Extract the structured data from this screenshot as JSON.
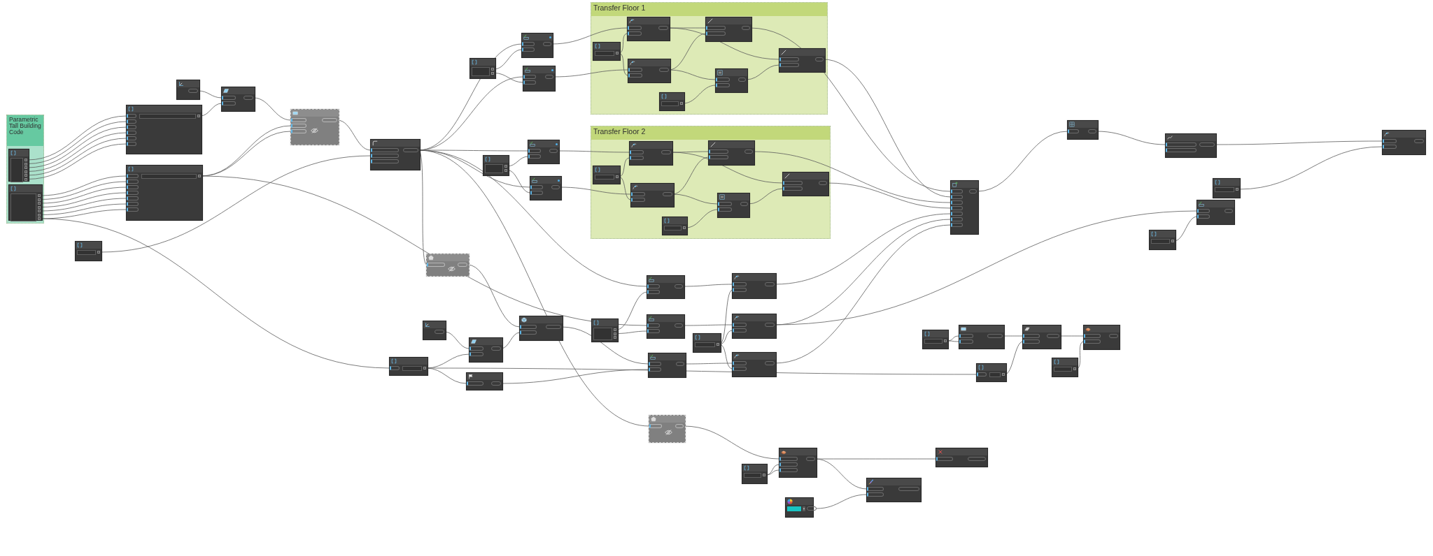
{
  "groups": [
    {
      "title": "Parametric Tall Building Code",
      "color": "#66c9a1"
    },
    {
      "title": "Transfer Floor 1",
      "color": "#c2d87a"
    },
    {
      "title": "Transfer Floor 2",
      "color": "#c2d87a"
    }
  ],
  "nodes": [
    {
      "kind": "code"
    },
    {
      "kind": "code"
    },
    {
      "kind": "function",
      "frozen": false
    },
    {
      "kind": "function",
      "frozen": false
    },
    {
      "kind": "code"
    },
    {
      "kind": "code"
    },
    {
      "kind": "function",
      "frozen": true
    },
    {
      "kind": "code"
    },
    {
      "kind": "function",
      "frozen": false
    },
    {
      "kind": "code"
    },
    {
      "kind": "function",
      "frozen": false
    },
    {
      "kind": "function",
      "frozen": false
    },
    {
      "kind": "code"
    },
    {
      "kind": "function",
      "frozen": false
    },
    {
      "kind": "function",
      "frozen": false
    },
    {
      "kind": "function",
      "frozen": false
    },
    {
      "kind": "code"
    },
    {
      "kind": "function",
      "frozen": false
    },
    {
      "kind": "function",
      "frozen": false
    },
    {
      "kind": "function",
      "frozen": false
    },
    {
      "kind": "function",
      "frozen": false
    },
    {
      "kind": "code"
    },
    {
      "kind": "function",
      "frozen": false
    },
    {
      "kind": "code"
    },
    {
      "kind": "function",
      "frozen": false
    },
    {
      "kind": "function",
      "frozen": false
    },
    {
      "kind": "function",
      "frozen": false
    },
    {
      "kind": "function",
      "frozen": false
    },
    {
      "kind": "code"
    },
    {
      "kind": "function",
      "frozen": true
    },
    {
      "kind": "function",
      "frozen": false
    },
    {
      "kind": "function",
      "frozen": false
    },
    {
      "kind": "function",
      "frozen": false
    },
    {
      "kind": "code"
    },
    {
      "kind": "function",
      "frozen": false
    },
    {
      "kind": "code"
    },
    {
      "kind": "function",
      "frozen": false
    },
    {
      "kind": "function",
      "frozen": false
    },
    {
      "kind": "function",
      "frozen": false
    },
    {
      "kind": "code"
    },
    {
      "kind": "function",
      "frozen": false
    },
    {
      "kind": "function",
      "frozen": false
    },
    {
      "kind": "function",
      "frozen": false
    },
    {
      "kind": "function",
      "frozen": false
    },
    {
      "kind": "function",
      "frozen": false
    },
    {
      "kind": "function",
      "frozen": false
    },
    {
      "kind": "function",
      "frozen": false
    },
    {
      "kind": "code"
    },
    {
      "kind": "function",
      "frozen": false
    },
    {
      "kind": "code"
    },
    {
      "kind": "code"
    },
    {
      "kind": "function",
      "frozen": false
    },
    {
      "kind": "function",
      "frozen": false
    },
    {
      "kind": "function",
      "frozen": false
    },
    {
      "kind": "code"
    },
    {
      "kind": "code"
    },
    {
      "kind": "function",
      "frozen": true
    },
    {
      "kind": "function",
      "frozen": false
    },
    {
      "kind": "code"
    },
    {
      "kind": "function",
      "frozen": false
    },
    {
      "kind": "function",
      "frozen": false
    },
    {
      "kind": "palette",
      "color": "#19c3c3"
    }
  ]
}
